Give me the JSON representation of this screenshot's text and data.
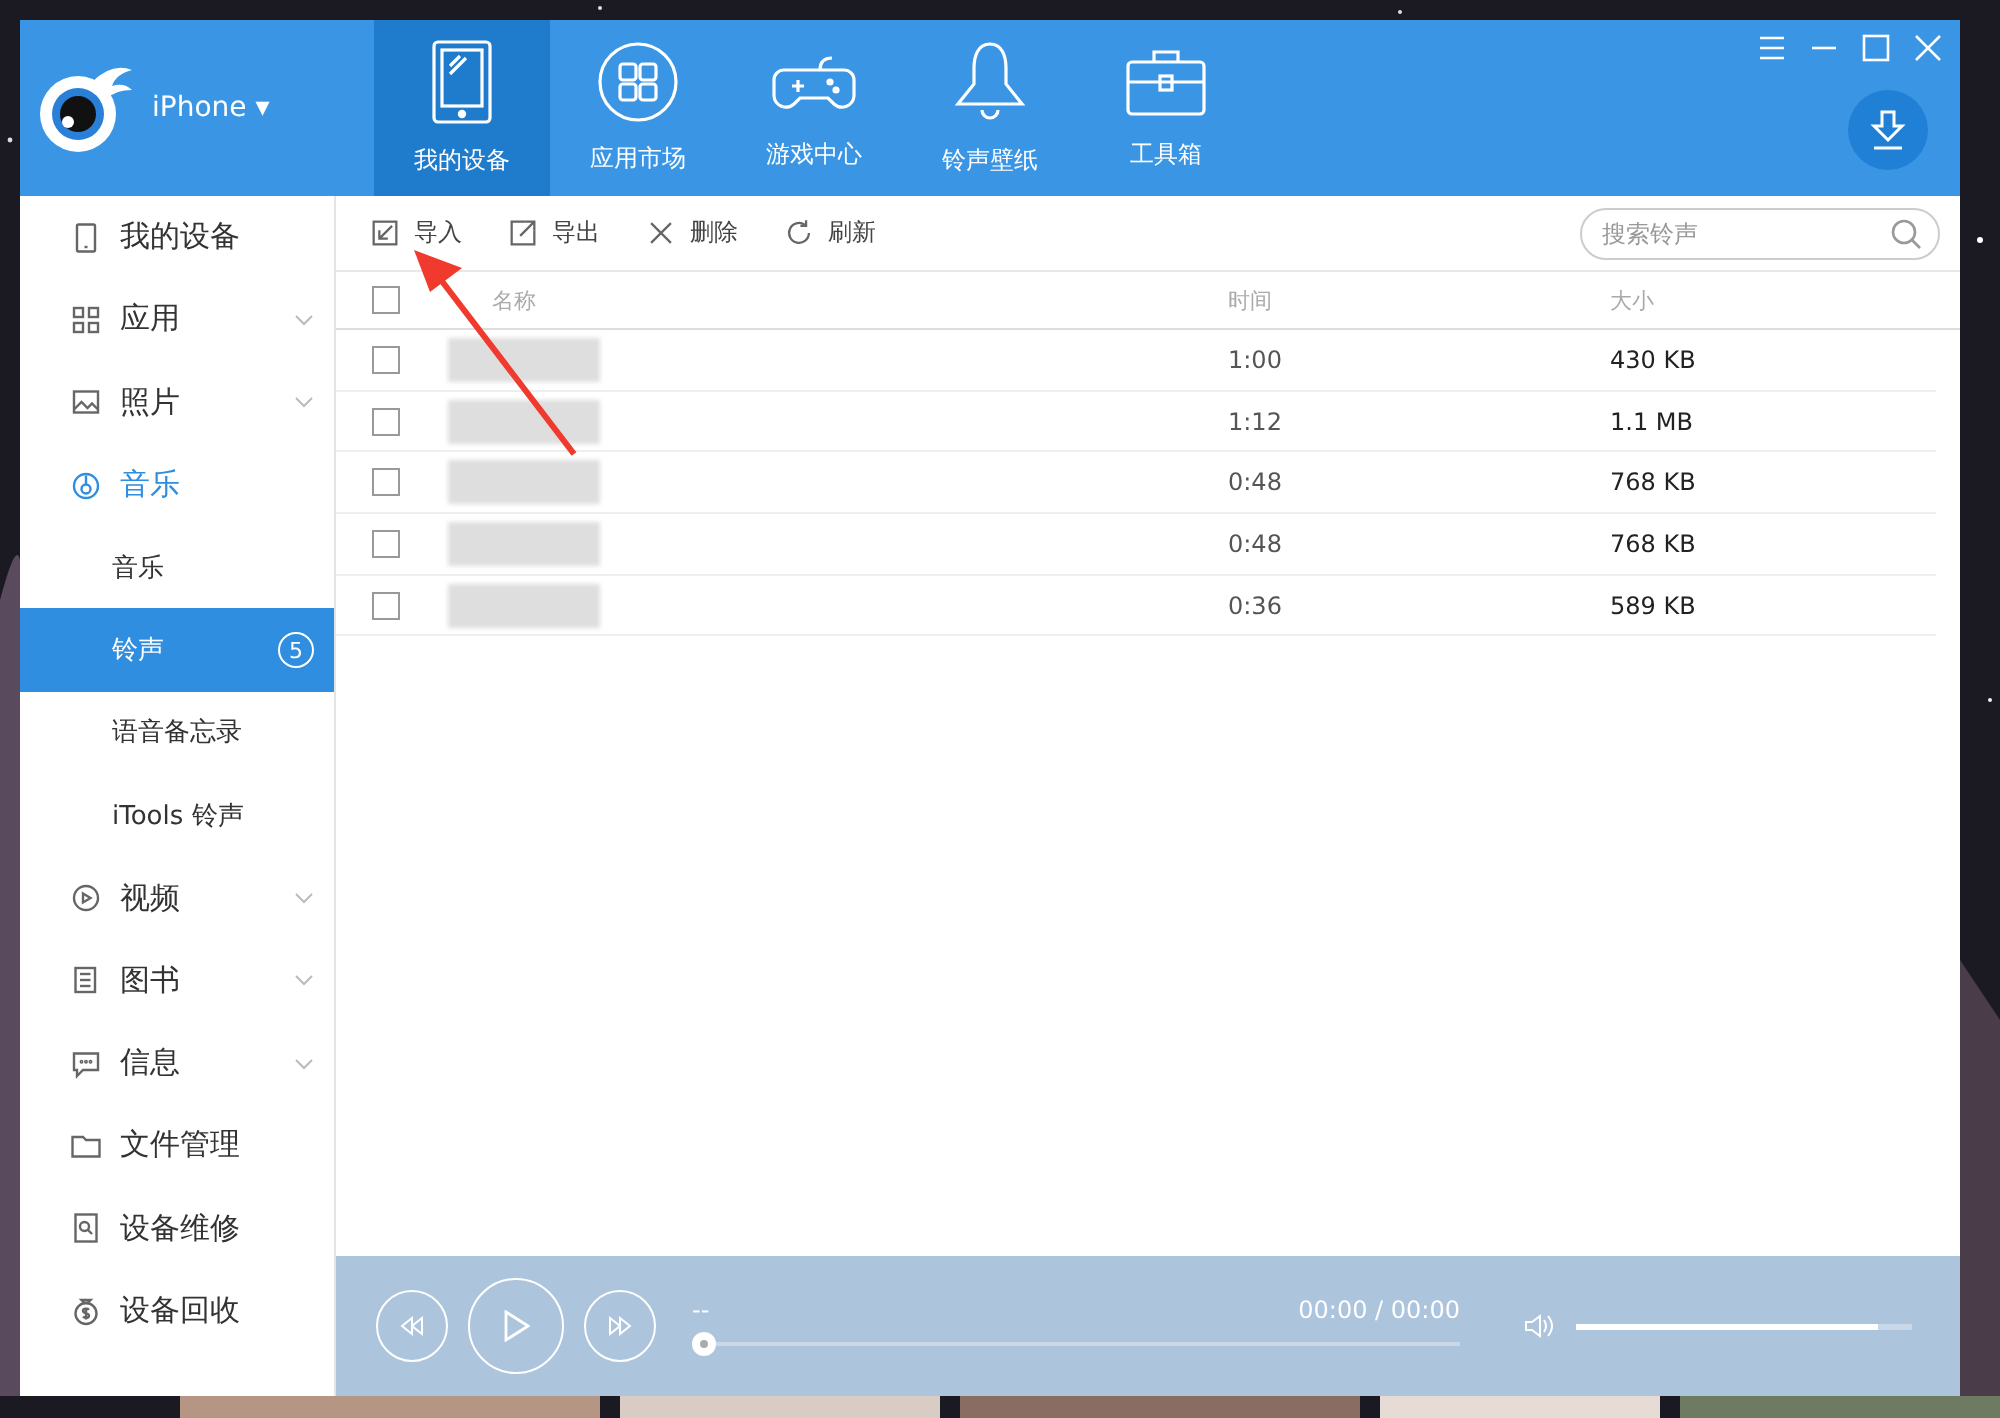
{
  "window": {
    "device": "iPhone ▾"
  },
  "tabs": [
    {
      "label": "我的设备",
      "selected": true
    },
    {
      "label": "应用市场",
      "selected": false
    },
    {
      "label": "游戏中心",
      "selected": false
    },
    {
      "label": "铃声壁纸",
      "selected": false
    },
    {
      "label": "工具箱",
      "selected": false
    }
  ],
  "sidebar": {
    "items": [
      {
        "kind": "section",
        "label": "我的设备",
        "expandable": false,
        "selected": false
      },
      {
        "kind": "section",
        "label": "应用",
        "expandable": true,
        "selected": false
      },
      {
        "kind": "section",
        "label": "照片",
        "expandable": true,
        "selected": false
      },
      {
        "kind": "section",
        "label": "音乐",
        "expandable": false,
        "selected": true
      },
      {
        "kind": "sub",
        "label": "音乐",
        "selected": false
      },
      {
        "kind": "sub",
        "label": "铃声",
        "selected": true,
        "badge": "5"
      },
      {
        "kind": "sub",
        "label": "语音备忘录",
        "selected": false
      },
      {
        "kind": "sub",
        "label": "iTools 铃声",
        "selected": false
      },
      {
        "kind": "section",
        "label": "视频",
        "expandable": true,
        "selected": false
      },
      {
        "kind": "section",
        "label": "图书",
        "expandable": true,
        "selected": false
      },
      {
        "kind": "section",
        "label": "信息",
        "expandable": true,
        "selected": false
      },
      {
        "kind": "section",
        "label": "文件管理",
        "expandable": false,
        "selected": false
      },
      {
        "kind": "section",
        "label": "设备维修",
        "expandable": false,
        "selected": false
      },
      {
        "kind": "section",
        "label": "设备回收",
        "expandable": false,
        "selected": false
      }
    ]
  },
  "toolbar": {
    "buttons": [
      "导入",
      "导出",
      "删除",
      "刷新"
    ],
    "search": {
      "placeholder": "搜索铃声"
    }
  },
  "table": {
    "all_checked": false,
    "columns": [
      "名称",
      "时间",
      "大小"
    ],
    "rows": [
      {
        "checked": false,
        "time": "1:00",
        "size": "430 KB"
      },
      {
        "checked": false,
        "time": "1:12",
        "size": "1.1 MB"
      },
      {
        "checked": false,
        "time": "0:48",
        "size": "768 KB"
      },
      {
        "checked": false,
        "time": "0:48",
        "size": "768 KB"
      },
      {
        "checked": false,
        "time": "0:36",
        "size": "589 KB"
      }
    ]
  },
  "player": {
    "title": "--",
    "time": "00:00 / 00:00",
    "progress": {
      "level": 0
    },
    "volume": {
      "level": 0.9
    }
  }
}
